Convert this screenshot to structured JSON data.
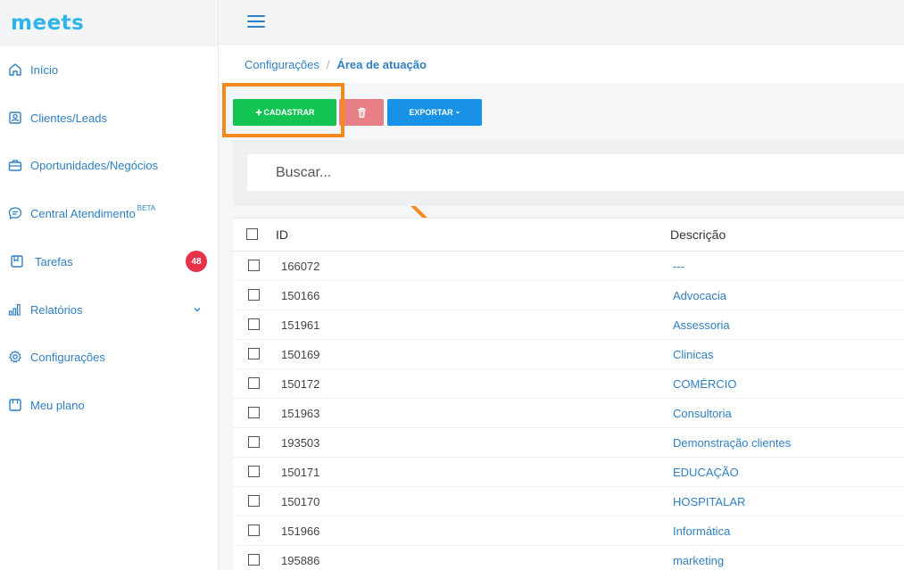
{
  "app": {
    "logo_text": "meets"
  },
  "sidebar": {
    "items": [
      {
        "label": "Início",
        "icon": "home-icon"
      },
      {
        "label": "Clientes/Leads",
        "icon": "contact-icon"
      },
      {
        "label": "Oportunidades/Negócios",
        "icon": "briefcase-icon"
      },
      {
        "label": "Central Atendimento",
        "sup": "BETA",
        "icon": "chat-icon"
      },
      {
        "label": "Tarefas",
        "icon": "tasks-icon",
        "badge": "48"
      },
      {
        "label": "Relatórios",
        "icon": "chart-icon",
        "has_submenu": true
      },
      {
        "label": "Configurações",
        "icon": "gear-icon"
      },
      {
        "label": "Meu plano",
        "icon": "plan-icon"
      }
    ]
  },
  "breadcrumb": {
    "parent": "Configurações",
    "separator": "/",
    "current": "Área de atuação"
  },
  "toolbar": {
    "add_label": "CADASTRAR",
    "export_label": "EXPORTAR"
  },
  "search": {
    "placeholder": "Buscar..."
  },
  "table": {
    "columns": [
      "ID",
      "Descrição"
    ],
    "rows": [
      {
        "id": "166072",
        "desc": "---"
      },
      {
        "id": "150166",
        "desc": "Advocacia"
      },
      {
        "id": "151961",
        "desc": "Assessoria"
      },
      {
        "id": "150169",
        "desc": "Clinicas"
      },
      {
        "id": "150172",
        "desc": "COMÉRCIO"
      },
      {
        "id": "151963",
        "desc": "Consultoria"
      },
      {
        "id": "193503",
        "desc": "Demonstração clientes"
      },
      {
        "id": "150171",
        "desc": "EDUCAÇÃO"
      },
      {
        "id": "150170",
        "desc": "HOSPITALAR"
      },
      {
        "id": "151966",
        "desc": "Informática"
      },
      {
        "id": "195886",
        "desc": "marketing"
      }
    ]
  },
  "colors": {
    "accent": "#2f7fc1",
    "add": "#14c453",
    "delete": "#e87f86",
    "export": "#1792e6",
    "highlight": "#f28a1d",
    "badge": "#e8324a"
  }
}
